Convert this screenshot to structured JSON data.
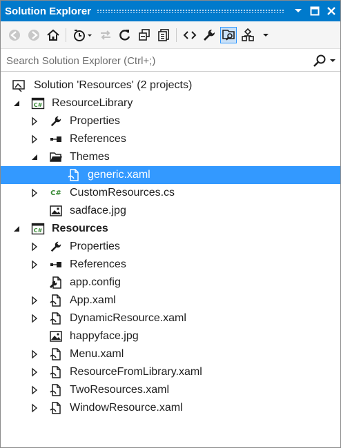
{
  "window": {
    "title": "Solution Explorer"
  },
  "search": {
    "placeholder": "Search Solution Explorer (Ctrl+;)"
  },
  "tree": {
    "solution": "Solution 'Resources' (2 projects)",
    "resourcelibrary": {
      "name": "ResourceLibrary",
      "items": {
        "properties": "Properties",
        "references": "References",
        "themes": "Themes",
        "generic": "generic.xaml",
        "customresources": "CustomResources.cs",
        "sadface": "sadface.jpg"
      }
    },
    "resources": {
      "name": "Resources",
      "items": {
        "properties": "Properties",
        "references": "References",
        "appconfig": "app.config",
        "appxaml": "App.xaml",
        "dynamicresource": "DynamicResource.xaml",
        "happyface": "happyface.jpg",
        "menu": "Menu.xaml",
        "resourcefromlibrary": "ResourceFromLibrary.xaml",
        "tworesources": "TwoResources.xaml",
        "windowresource": "WindowResource.xaml"
      }
    }
  },
  "icons": {
    "cs_badge": "C#"
  },
  "colors": {
    "accent": "#007acc",
    "selection": "#3399ff",
    "csharp_green": "#388a34"
  }
}
